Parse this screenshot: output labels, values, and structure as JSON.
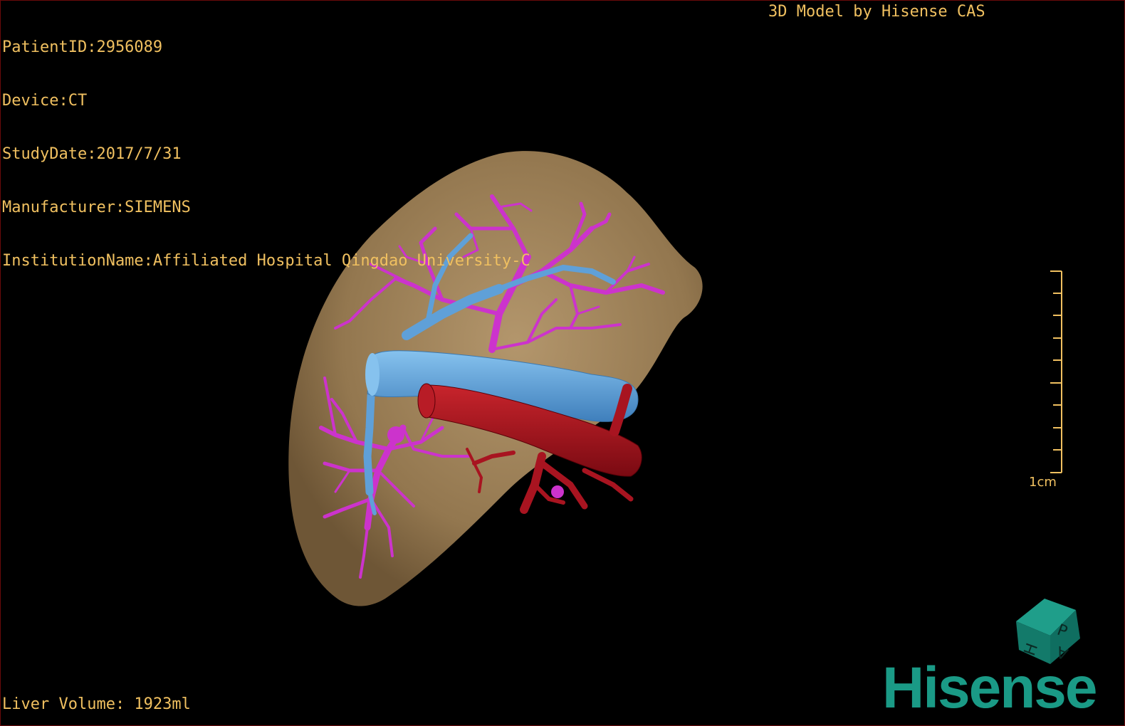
{
  "overlay": {
    "patient_id": "PatientID:2956089",
    "device": "Device:CT",
    "study_date": "StudyDate:2017/7/31",
    "manufacturer": "Manufacturer:SIEMENS",
    "institution": "InstitutionName:Affiliated Hospital Qingdao University-C",
    "model_credit": "3D Model by Hisense CAS",
    "liver_volume": "Liver Volume: 1923ml"
  },
  "scale": {
    "label": "1cm"
  },
  "orientation_cube": {
    "faces": [
      "P",
      "H",
      "A"
    ]
  },
  "brand": {
    "name": "Hisense"
  },
  "colors": {
    "text": "#f0c060",
    "liver": "#9c8058",
    "portal_vein": "#5fa0d8",
    "arteries": "#a81420",
    "bile_ducts": "#cc33cc",
    "brand": "#1a9a86"
  }
}
